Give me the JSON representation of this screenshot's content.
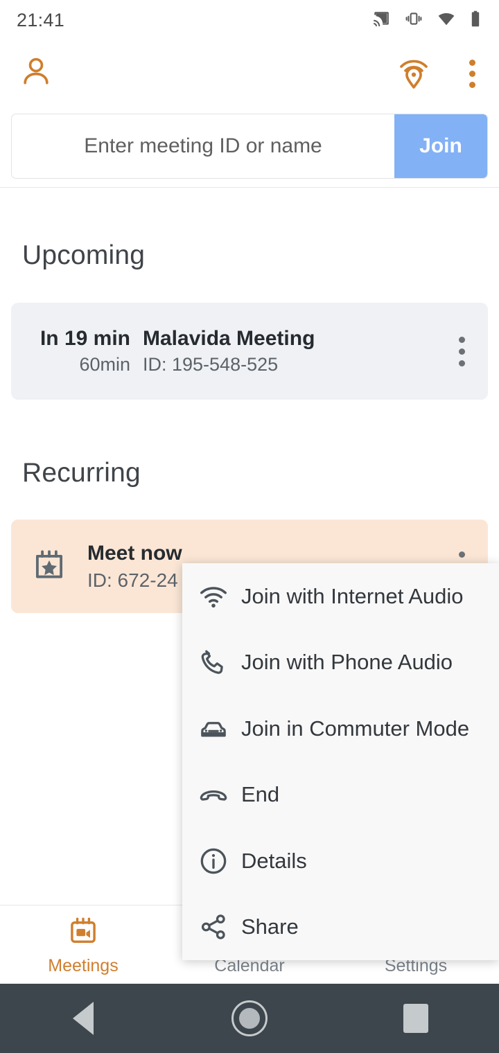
{
  "status_bar": {
    "time": "21:41",
    "icons": [
      "cast-icon",
      "vibrate-icon",
      "wifi-icon",
      "battery-icon"
    ]
  },
  "app_bar": {
    "profile_icon": "person-icon",
    "nearby_icon": "nearby-pin-icon",
    "overflow_icon": "more-vert-icon"
  },
  "search": {
    "placeholder": "Enter meeting ID or name",
    "value": "",
    "join_label": "Join"
  },
  "sections": {
    "upcoming_title": "Upcoming",
    "recurring_title": "Recurring"
  },
  "upcoming_meeting": {
    "when": "In 19 min",
    "duration": "60min",
    "name": "Malavida Meeting",
    "id": "ID: 195-548-525",
    "kebab_icon": "more-vert-icon"
  },
  "recurring_meeting": {
    "icon": "calendar-star-icon",
    "name": "Meet now",
    "id": "ID: 672-24",
    "kebab_icon": "more-vert-icon"
  },
  "popup_menu": {
    "items": [
      {
        "label": "Join with Internet Audio",
        "icon": "wifi-icon"
      },
      {
        "label": "Join with Phone Audio",
        "icon": "phone-icon"
      },
      {
        "label": "Join in Commuter Mode",
        "icon": "car-icon"
      },
      {
        "label": "End",
        "icon": "call-end-icon"
      },
      {
        "label": "Details",
        "icon": "info-circle-icon"
      },
      {
        "label": "Share",
        "icon": "share-icon"
      }
    ]
  },
  "bottom_nav": {
    "items": [
      {
        "label": "Meetings",
        "icon": "calendar-video-icon",
        "active": true
      },
      {
        "label": "Calendar",
        "icon": "calendar-icon",
        "active": false
      },
      {
        "label": "Settings",
        "icon": "gear-icon",
        "active": false
      }
    ]
  },
  "android_nav": {
    "back": "back-triangle-icon",
    "home": "home-circle-icon",
    "recents": "recents-square-icon"
  },
  "colors": {
    "accent_orange": "#cf7e2c",
    "join_blue": "#82b1f5",
    "upcoming_card_bg": "#eff1f5",
    "recurring_card_bg": "#fbe6d6",
    "menu_bg": "#f8f8f8",
    "nav_bar_bg": "#3d464c"
  }
}
